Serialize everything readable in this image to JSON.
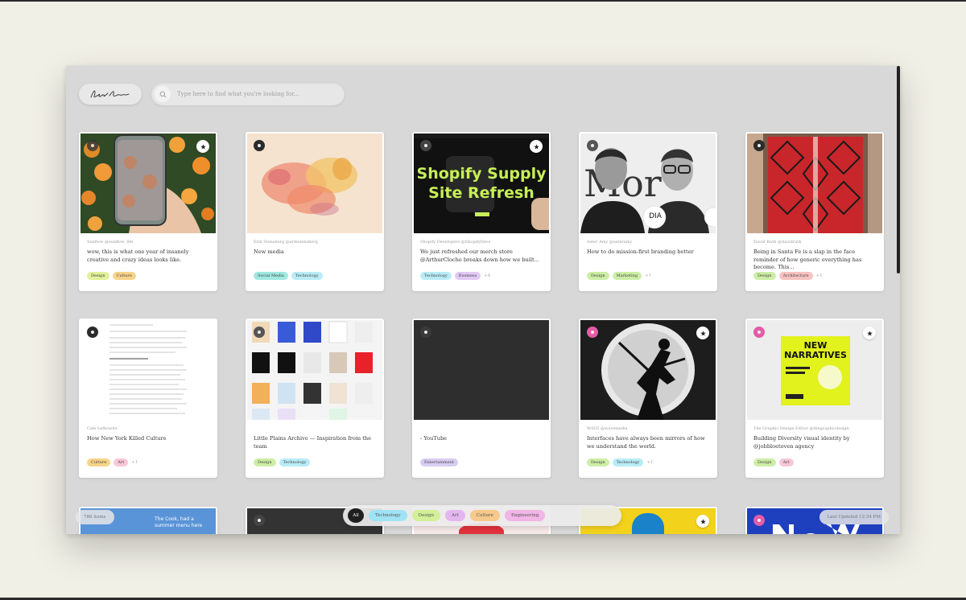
{
  "app": {
    "search_placeholder": "Type here to find what you're looking for...",
    "bottom_left": "786 items",
    "bottom_right": "Last Updated 12:34 PM"
  },
  "colors": {
    "background": "#f1f0e7",
    "window": "#d8d8d8",
    "tag_design": "#e0f29a",
    "tag_culture": "#f7d48a",
    "tag_social": "#9fe9e0",
    "tag_technology": "#b8ecf7",
    "tag_business": "#e2c9f5",
    "tag_marketing": "#cdeea5",
    "tag_architecture": "#f7c2c2",
    "tag_art": "#f7c7d8",
    "tag_entertainment": "#d8ccf3"
  },
  "filters": [
    "All",
    "Technology",
    "Design",
    "Art",
    "Culture",
    "Engineering"
  ],
  "cards": [
    {
      "meta": "Sunflow @sunflow_life",
      "desc": "wow, this is what one year of insanely creative and crazy ideas looks like.",
      "tags": [
        "Design",
        "Culture"
      ],
      "more": ""
    },
    {
      "meta": "Erik Stensberg @erikstensberg",
      "desc": "New media",
      "tags": [
        "Social Media",
        "Technology"
      ],
      "more": ""
    },
    {
      "meta": "Shopify Developers @ShopifyDevs",
      "desc": "We just refreshed our merch store @ArthurCloche breaks down how we built...",
      "tags": [
        "Technology",
        "Business"
      ],
      "more": "+4",
      "thumb_text": [
        "Shopify Supply",
        "Site Refresh"
      ]
    },
    {
      "meta": "Aster Amy @asteramy",
      "desc": "How to do mission-first branding better",
      "tags": [
        "Design",
        "Marketing"
      ],
      "more": "+1",
      "thumb_text": [
        "DIA"
      ]
    },
    {
      "meta": "David Ruth @davidruth",
      "desc": "Being in Santa Fe is a slap in the face reminder of how generic everything has become. This...",
      "tags": [
        "Design",
        "Architecture"
      ],
      "more": "+1"
    },
    {
      "meta": "Cale Lefkowitz",
      "desc": "How New York Killed Culture",
      "tags": [
        "Culture",
        "Art"
      ],
      "more": "+1"
    },
    {
      "meta": "",
      "desc": "Little Plains Archive — Inspiration from the team",
      "tags": [
        "Design",
        "Technology"
      ],
      "more": ""
    },
    {
      "meta": "",
      "desc": "- YouTube",
      "tags": [
        "Entertainment"
      ],
      "more": ""
    },
    {
      "meta": "WAVE @wavemedia",
      "desc": "Interfaces have always been mirrors of how we understand the world.",
      "tags": [
        "Design",
        "Technology"
      ],
      "more": "+1"
    },
    {
      "meta": "The Graphic Design Editor @thegraphicdesign",
      "desc": "Building Diversity visual identity by @jobbloetoven agency",
      "tags": [
        "Design",
        "Art"
      ],
      "more": "",
      "thumb_text": [
        "NEW",
        "NARRATIVES"
      ]
    }
  ],
  "row3": {
    "card1_text": "The Cook, had a summer menu here"
  }
}
